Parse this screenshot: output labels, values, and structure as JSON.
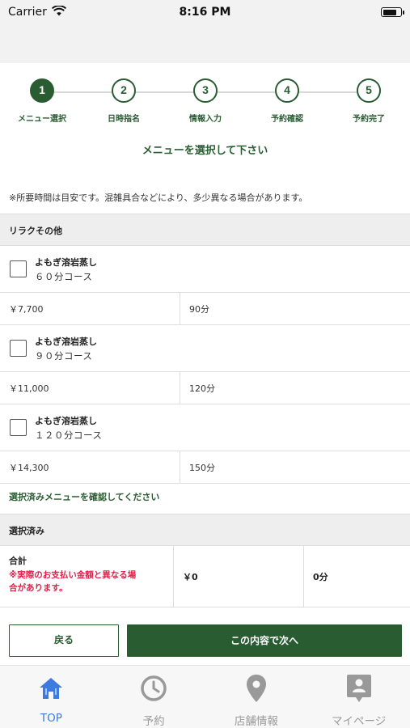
{
  "status_bar": {
    "carrier": "Carrier",
    "time": "8:16 PM"
  },
  "steps": [
    {
      "number": "1",
      "label": "メニュー選択",
      "active": true
    },
    {
      "number": "2",
      "label": "日時指名",
      "active": false
    },
    {
      "number": "3",
      "label": "情報入力",
      "active": false
    },
    {
      "number": "4",
      "label": "予約確認",
      "active": false
    },
    {
      "number": "5",
      "label": "予約完了",
      "active": false
    }
  ],
  "heading": "メニューを選択して下さい",
  "notice": "※所要時間は目安です。混雑具合などにより、多少異なる場合があります。",
  "category": "リラクその他",
  "menu_items": [
    {
      "name": "よもぎ溶岩蒸し",
      "course": "６０分コース",
      "price": "￥7,700",
      "duration": "90分",
      "checked": false
    },
    {
      "name": "よもぎ溶岩蒸し",
      "course": "９０分コース",
      "price": "￥11,000",
      "duration": "120分",
      "checked": false
    },
    {
      "name": "よもぎ溶岩蒸し",
      "course": "１２０分コース",
      "price": "￥14,300",
      "duration": "150分",
      "checked": false
    }
  ],
  "confirm_link": "選択済みメニューを確認してください",
  "selected": {
    "header": "選択済み",
    "total_label": "合計",
    "warning": "※実際のお支払い金額と異なる場合があります。",
    "warning_line1": "※実際のお支払い金額と異なる場",
    "warning_line2": "合があります。",
    "total_price": "￥0",
    "total_time": "0分"
  },
  "buttons": {
    "back": "戻る",
    "next": "この内容で次へ"
  },
  "tabs": [
    {
      "label": "TOP",
      "icon": "home-icon",
      "active": true
    },
    {
      "label": "予約",
      "icon": "clock-icon",
      "active": false
    },
    {
      "label": "店舗情報",
      "icon": "location-pin-icon",
      "active": false
    },
    {
      "label": "マイページ",
      "icon": "profile-card-icon",
      "active": false
    }
  ],
  "colors": {
    "primary_green": "#2a5c32",
    "warning_red": "#e0204a",
    "tab_active_blue": "#3d7be0",
    "tab_inactive_gray": "#999999"
  }
}
